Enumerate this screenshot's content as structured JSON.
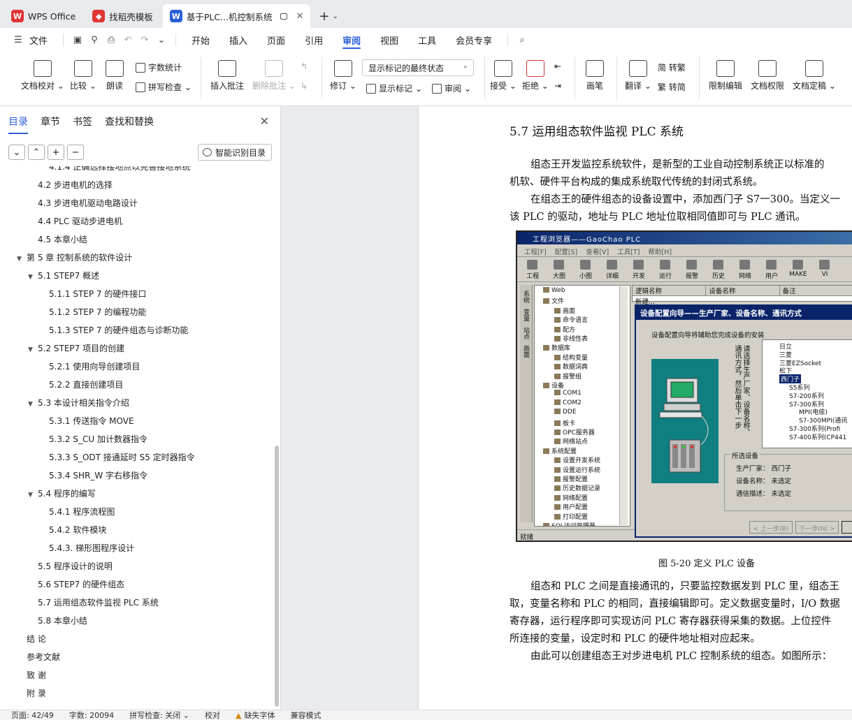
{
  "tabs": [
    {
      "label": "WPS Office",
      "logo_color": "#e03535"
    },
    {
      "label": "找稻壳模板",
      "logo_color": "#e03535"
    },
    {
      "label": "基于PLC...机控制系统",
      "logo_color": "#2b5fd9",
      "active": true
    }
  ],
  "menu": {
    "file": "文件",
    "items": [
      "开始",
      "插入",
      "页面",
      "引用",
      "审阅",
      "视图",
      "工具",
      "会员专享"
    ],
    "active": "审阅"
  },
  "ribbon": {
    "doc_check": "文档校对",
    "compare": "比较",
    "read_aloud": "朗读",
    "word_count": "字数统计",
    "spell_check": "拼写检查",
    "insert_comment": "插入批注",
    "delete_comment": "删除批注",
    "revise": "修订",
    "show_mode": "显示标记的最终状态",
    "show_marks": "显示标记",
    "review": "审阅",
    "accept": "接受",
    "reject": "拒绝",
    "pen": "画笔",
    "translate": "翻译",
    "to_traditional": "简 转繁",
    "to_simplified": "繁 转简",
    "restrict_edit": "限制编辑",
    "doc_permission": "文档权限",
    "doc_finalize": "文档定稿"
  },
  "nav": {
    "tabs": [
      "目录",
      "章节",
      "书签",
      "查找和替换"
    ],
    "smart_btn": "智能识别目录",
    "toc": [
      {
        "text": "4.1.4 正确选择接地点以完善接地系统",
        "level": 3
      },
      {
        "text": "4.2 步进电机的选择",
        "level": 2
      },
      {
        "text": "4.3 步进电机驱动电路设计",
        "level": 2
      },
      {
        "text": "4.4 PLC 驱动步进电机",
        "level": 2
      },
      {
        "text": "4.5 本章小结",
        "level": 2
      },
      {
        "text": "第 5 章 控制系统的软件设计",
        "level": 1,
        "expand": true
      },
      {
        "text": "5.1 STEP7 概述",
        "level": 2,
        "expand": true
      },
      {
        "text": "5.1.1 STEP 7 的硬件接口",
        "level": 3
      },
      {
        "text": "5.1.2 STEP 7 的编程功能",
        "level": 3
      },
      {
        "text": "5.1.3 STEP 7 的硬件组态与诊断功能",
        "level": 3
      },
      {
        "text": "5.2 STEP7 项目的创建",
        "level": 2,
        "expand": true
      },
      {
        "text": "5.2.1 使用向导创建项目",
        "level": 3
      },
      {
        "text": "5.2.2 直接创建项目",
        "level": 3
      },
      {
        "text": "5.3 本设计相关指令介绍",
        "level": 2,
        "expand": true
      },
      {
        "text": "5.3.1 传送指令 MOVE",
        "level": 3
      },
      {
        "text": "5.3.2 S_CU 加计数器指令",
        "level": 3
      },
      {
        "text": "5.3.3 S_ODT 接通延时 S5 定时器指令",
        "level": 3
      },
      {
        "text": "5.3.4 SHR_W 字右移指令",
        "level": 3
      },
      {
        "text": "5.4 程序的编写",
        "level": 2,
        "expand": true
      },
      {
        "text": "5.4.1 程序流程图",
        "level": 3
      },
      {
        "text": "5.4.2 软件模块",
        "level": 3
      },
      {
        "text": "5.4.3. 梯形图程序设计",
        "level": 3
      },
      {
        "text": "5.5 程序设计的说明",
        "level": 2
      },
      {
        "text": "5.6 STEP7 的硬件组态",
        "level": 2
      },
      {
        "text": "5.7 运用组态软件监视 PLC 系统",
        "level": 2
      },
      {
        "text": "5.8 本章小结",
        "level": 2
      },
      {
        "text": "结 论",
        "level": 1
      },
      {
        "text": "参考文献",
        "level": 1
      },
      {
        "text": "致 谢",
        "level": 1
      },
      {
        "text": "附 录",
        "level": 1
      }
    ]
  },
  "doc": {
    "heading": "5.7  运用组态软件监视 PLC 系统",
    "p1a": "组态王开发监控系统软件，是新型的工业自动控制系统正以标准的",
    "p1b": "机软、硬件平台构成的集成系统取代传统的封闭式系统。",
    "p2a": "在组态王的硬件组态的设备设置中，添加西门子 S7一300。当定义一",
    "p2b": "该 PLC 的驱动，地址与 PLC 地址位取相同值即可与 PLC 通讯。",
    "caption": "图 5-20  定义 PLC 设备",
    "p3a": "组态和 PLC 之间是直接通讯的，只要监控数据发到 PLC 里，组态王",
    "p3b": "取，变量名称和 PLC 的相同，直接编辑即可。定义数据变量时，I/O 数据",
    "p3c": "寄存器，运行程序即可实现访问 PLC 寄存器获得采集的数据。上位控件",
    "p3d": "所连接的变量，设定时和 PLC 的硬件地址相对应起来。",
    "p4": "由此可以创建组态王对步进电机 PLC 控制系统的组态。如图所示："
  },
  "figure": {
    "title": "工程浏览器——GaoChao PLC",
    "menus": [
      "工程[F]",
      "配置[S]",
      "查看[V]",
      "工具[T]",
      "帮助[H]"
    ],
    "tools": [
      "工程",
      "大图",
      "小图",
      "详细",
      "开发",
      "运行",
      "报警",
      "历史",
      "网络",
      "用户",
      "MAKE",
      "VI"
    ],
    "side_tabs": [
      "系统",
      "变量",
      "站点",
      "画面"
    ],
    "tree": [
      {
        "t": "Web",
        "d": 0
      },
      {
        "t": "文件",
        "d": 0
      },
      {
        "t": "画面",
        "d": 1
      },
      {
        "t": "命令语言",
        "d": 1
      },
      {
        "t": "配方",
        "d": 1
      },
      {
        "t": "非线性表",
        "d": 1
      },
      {
        "t": "数据库",
        "d": 0
      },
      {
        "t": "结构变量",
        "d": 1
      },
      {
        "t": "数据词典",
        "d": 1
      },
      {
        "t": "报警组",
        "d": 1
      },
      {
        "t": "设备",
        "d": 0
      },
      {
        "t": "COM1",
        "d": 1
      },
      {
        "t": "COM2",
        "d": 1
      },
      {
        "t": "DDE",
        "d": 1
      },
      {
        "t": "板卡",
        "d": 1
      },
      {
        "t": "OPC服务器",
        "d": 1
      },
      {
        "t": "网络站点",
        "d": 1
      },
      {
        "t": "系统配置",
        "d": 0
      },
      {
        "t": "设置开发系统",
        "d": 1
      },
      {
        "t": "设置运行系统",
        "d": 1
      },
      {
        "t": "报警配置",
        "d": 1
      },
      {
        "t": "历史数据记录",
        "d": 1
      },
      {
        "t": "网络配置",
        "d": 1
      },
      {
        "t": "用户配置",
        "d": 1
      },
      {
        "t": "打印配置",
        "d": 1
      },
      {
        "t": "SQL访问管理器",
        "d": 0
      }
    ],
    "list_headers": [
      "逻辑名称",
      "设备名称",
      "备注"
    ],
    "new_item": "新建...",
    "status": "就绪",
    "wizard": {
      "title": "设备配置向导——生产厂家、设备名称、通讯方式",
      "desc": "设备配置向导将辅助您完成设备的安装",
      "vert1": "请选择生产厂家、设备名称、",
      "vert2": "通讯方式，然后单击下一步",
      "tree": [
        {
          "t": "日立",
          "d": 0
        },
        {
          "t": "三菱",
          "d": 0
        },
        {
          "t": "三菱EZSocket",
          "d": 0
        },
        {
          "t": "松下",
          "d": 0
        },
        {
          "t": "西门子",
          "d": 0,
          "sel": true
        },
        {
          "t": "S5系列",
          "d": 1
        },
        {
          "t": "S7-200系列",
          "d": 1
        },
        {
          "t": "S7-300系列",
          "d": 1
        },
        {
          "t": "MPI(电缆)",
          "d": 2
        },
        {
          "t": "S7-300MPI(通讯",
          "d": 2
        },
        {
          "t": "S7-300系列(Profi",
          "d": 1
        },
        {
          "t": "S7-400系列(CP441",
          "d": 1
        }
      ],
      "selected_label": "所选设备",
      "vendor": "生产厂家：  西门子",
      "device": "设备名称：  未选定",
      "comm": "通信描述：  未选定",
      "prev": "< 上一步(B)",
      "next": "下一步(N) >"
    }
  },
  "status": {
    "page": "页面: 42/49",
    "words": "字数: 20094",
    "spell": "拼写检查: 关闭 ⌄",
    "proof": "校对",
    "missing_font": "缺失字体",
    "compat": "兼容模式"
  },
  "colors": {
    "accent": "#2b5fd9",
    "wps_red": "#e03535"
  }
}
